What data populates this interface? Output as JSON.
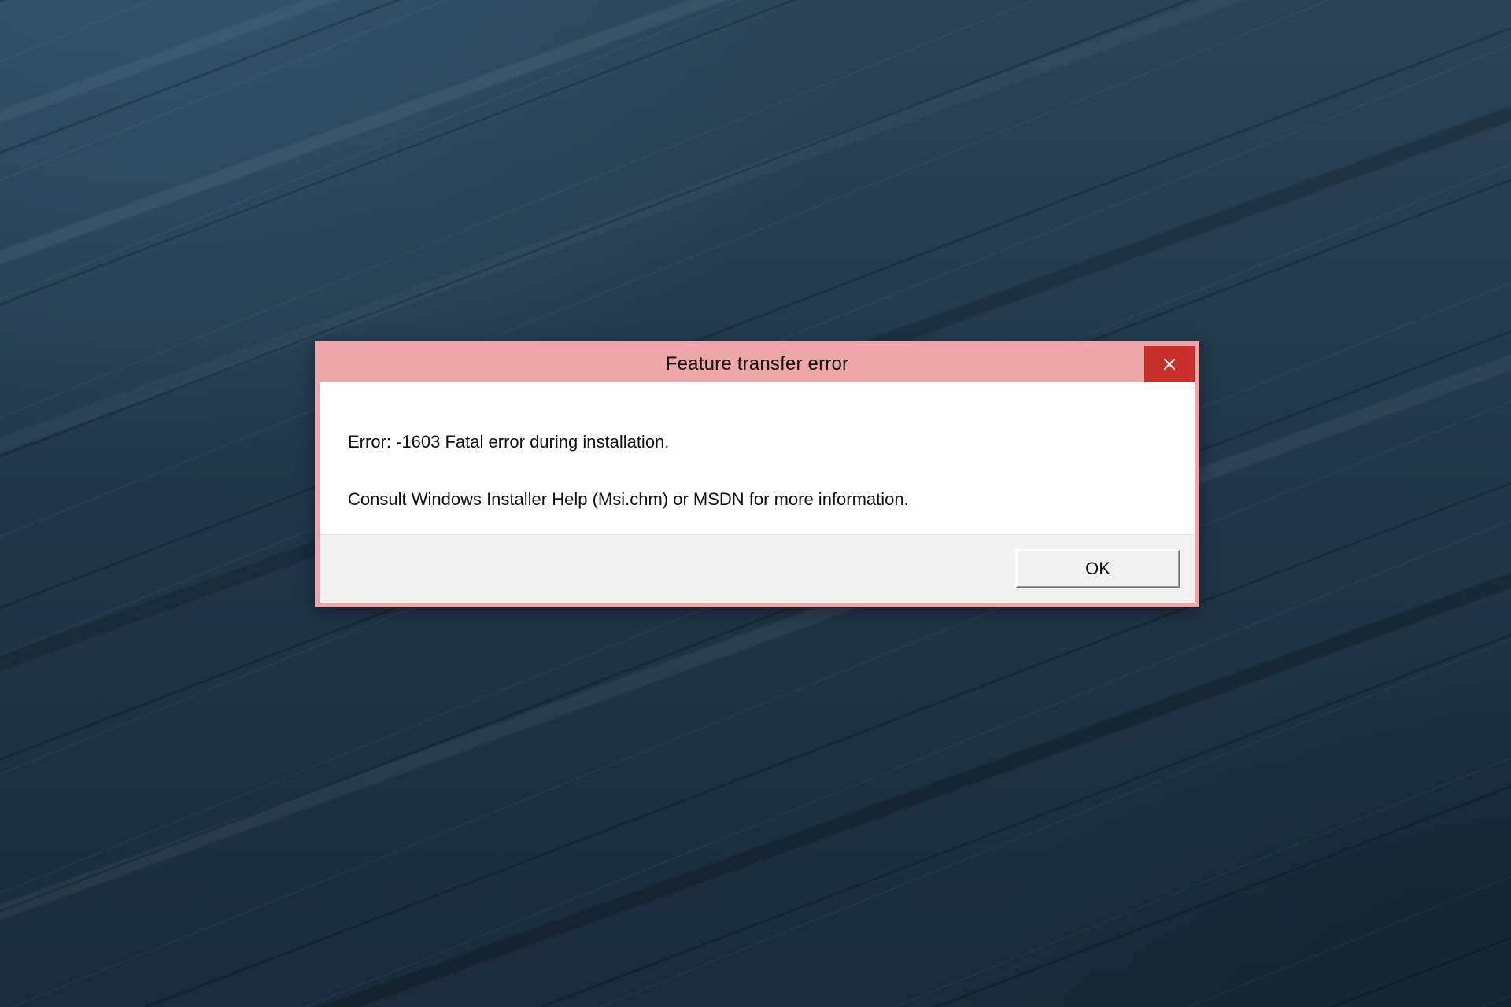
{
  "dialog": {
    "title": "Feature transfer error",
    "message_line_1": "Error: -1603  Fatal error during installation.",
    "message_line_2": "Consult Windows Installer Help (Msi.chm) or MSDN for more information.",
    "buttons": {
      "ok": "OK"
    },
    "icons": {
      "close": "close-icon"
    },
    "colors": {
      "titlebar_bg": "#eea7a9",
      "close_bg": "#c9302c",
      "button_face": "#f1f1f1",
      "text": "#111111"
    }
  }
}
